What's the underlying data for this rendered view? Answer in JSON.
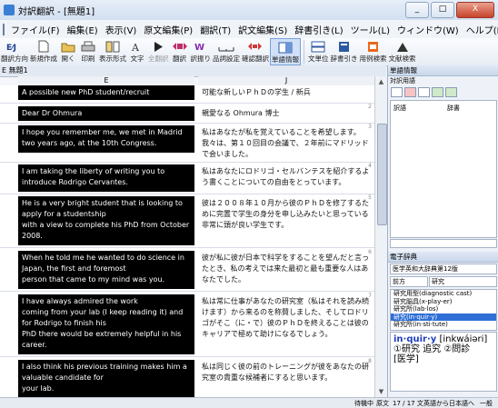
{
  "window": {
    "title": "対訳翻訳 - [無題1]",
    "buttons": {
      "minimize": "_",
      "maximize": "□",
      "close": "X"
    }
  },
  "menubar": {
    "items": [
      "ファイル(F)",
      "編集(E)",
      "表示(V)",
      "原文編集(P)",
      "翻訳(T)",
      "訳文編集(S)",
      "辞書引き(L)",
      "ツール(L)",
      "ウィンドウ(W)",
      "ヘルプ(H)"
    ]
  },
  "toolbar": {
    "buttons": [
      {
        "label": "翻訳方向",
        "icon": "direction-icon"
      },
      {
        "label": "新規作成",
        "icon": "new-file-icon"
      },
      {
        "label": "開く",
        "icon": "open-folder-icon"
      },
      {
        "label": "印刷",
        "icon": "print-icon"
      },
      {
        "label": "表示形式",
        "icon": "layout-icon"
      },
      {
        "label": "文字",
        "icon": "font-icon"
      },
      {
        "label": "全翻訳",
        "icon": "play-icon"
      },
      {
        "label": "翻訳",
        "icon": "translate-icon"
      },
      {
        "label": "訳振り",
        "icon": "ruby-icon"
      },
      {
        "label": "品詞設定",
        "icon": "pos-icon"
      },
      {
        "label": "確認翻訳",
        "icon": "back-translate-icon"
      },
      {
        "label": "単語情報",
        "icon": "word-info-icon"
      },
      {
        "label": "文単位",
        "icon": "sentence-unit-icon"
      },
      {
        "label": "辞書引き",
        "icon": "dictionary-icon"
      },
      {
        "label": "用例検索",
        "icon": "example-search-icon"
      },
      {
        "label": "文献検索",
        "icon": "literature-search-icon"
      }
    ]
  },
  "document": {
    "tab": "E 無題1",
    "col_e": "E",
    "col_j": "J"
  },
  "rows": [
    {
      "num": "1",
      "en": [
        "A possible new PhD student/recruit"
      ],
      "ja": [
        "可能な新しいＰｈＤの学生 / 新兵"
      ]
    },
    {
      "num": "2",
      "en": [
        "Dear Dr Ohmura"
      ],
      "ja": [
        "親愛なる Ohmura 博士"
      ]
    },
    {
      "num": "3",
      "en": [
        "I hope you remember me, we met in Madrid",
        "two years ago, at the 10th Congress."
      ],
      "ja": [
        "私はあなたが私を覚えていることを希望します。",
        "我々は、第１０回目の会議で、２年前にマドリッド",
        "で会いました。"
      ]
    },
    {
      "num": "4",
      "en": [
        "I am taking the liberty of writing you to",
        "introduce Rodrigo Cervantes."
      ],
      "ja": [
        "私はあなたにロドリゴ・セルバンテスを紹介するよ",
        "う書くことについての自由をとっています。"
      ]
    },
    {
      "num": "5",
      "en": [
        "He is a very bright student that is  looking to",
        "apply for a studentship",
        "with a view to complete his PhD from October",
        "2008."
      ],
      "ja": [
        "彼は２００８年１０月から彼のＰｈＤを修了するた",
        "めに完置で学生の身分を申し込みたいと思っている",
        "非常に頭が良い学生です。"
      ]
    },
    {
      "num": "6",
      "en": [
        "When he told me he wanted to do science in",
        "Japan, the first and foremost",
        "person that came to my mind was you."
      ],
      "ja": [
        "彼が私に彼が日本で科学をすることを望んだと言っ",
        "たとき、私の考えでは来た最初と最も重要な人はあ",
        "なたでした。"
      ]
    },
    {
      "num": "7",
      "en": [
        "I have always admired the work",
        "coming from your lab (I keep reading it) and",
        "for Rodrigo to finish his",
        "PhD there would be extremely helpful in his",
        "career."
      ],
      "ja": [
        "私は常に仕事があなたの研究室（私はそれを読み続",
        "けます）から来るのを称賛しました、そしてロドリ",
        "ゴがそこ（に・で）彼のＰｈＤを終えることは彼の",
        "キャリアで極めて助けになるでしょう。"
      ]
    },
    {
      "num": "8",
      "en": [
        "I also think his previous training makes him a",
        "valuable candidate for",
        "your lab."
      ],
      "ja": [
        "私は同じく彼の前のトレーニングが彼をあなたの研",
        "究室の貴重な候補者にすると思います。"
      ]
    }
  ],
  "word_panel": {
    "title": "単語情報",
    "subtitle": "対訳用語",
    "col1": "訳語",
    "col2": "辞書"
  },
  "dict_panel": {
    "title": "電子辞典",
    "dictionary": "医学英和大辞典第12版",
    "mode": "前方",
    "query": "研究",
    "entries": [
      "研究用型(diagnostic cast)",
      "研究脳具(x-play-er)",
      "研究所(lab·los)",
      "研究(in·quir·y)",
      "研究所(in·sti·tute)"
    ],
    "selected_index": 3,
    "definition": {
      "headword": "in·quir·y",
      "pron": "[inkwáiəri]",
      "sense": "①研究 追究 ②問診",
      "field": "[医学]"
    }
  },
  "status": {
    "left": "待機中",
    "mid": "原文",
    "count": "17 / 17 文",
    "direction": "英語から日本語へ",
    "right": "一般"
  }
}
